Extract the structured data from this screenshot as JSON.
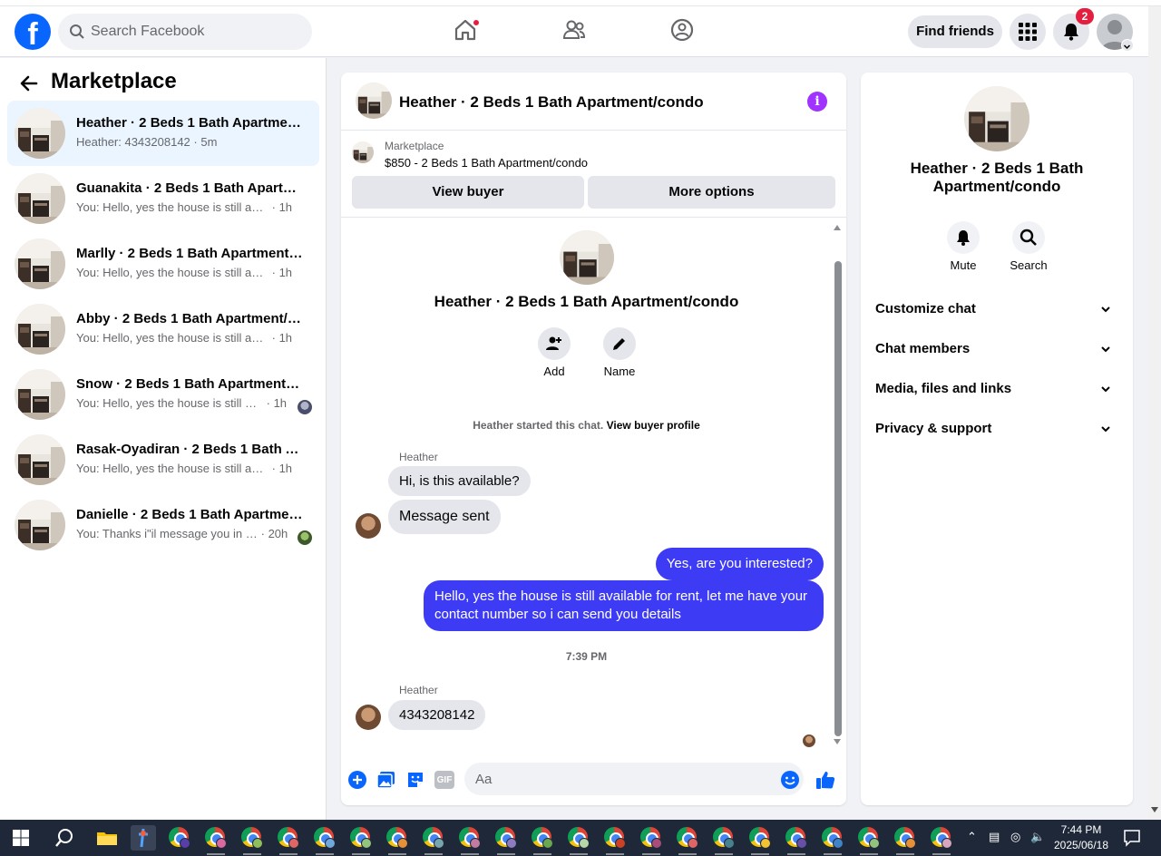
{
  "topbar": {
    "logo": "f",
    "search_placeholder": "Search Facebook",
    "nav_icons": [
      "home-icon",
      "friends-icon",
      "groups-icon"
    ],
    "find_friends": "Find friends",
    "notification_count": "2"
  },
  "left": {
    "title": "Marketplace",
    "conversations": [
      {
        "name": "Heather · 2 Beds 1 Bath Apartment/condo",
        "preview": "Heather: 4343208142",
        "time": "5m",
        "active": true
      },
      {
        "name": "Guanakita · 2 Beds 1 Bath Apartment/condo",
        "preview": "You: Hello, yes the house is still available for rent",
        "time": "1h"
      },
      {
        "name": "Marlly · 2 Beds 1 Bath Apartment/condo",
        "preview": "You: Hello, yes the house is still available for rent",
        "time": "1h"
      },
      {
        "name": "Abby · 2 Beds 1 Bath Apartment/condo",
        "preview": "You: Hello, yes the house is still available for rent",
        "time": "1h"
      },
      {
        "name": "Snow · 2 Beds 1 Bath Apartment/condo",
        "preview": "You: Hello, yes the house is still available for rent",
        "time": "1h"
      },
      {
        "name": "Rasak-Oyadiran · 2 Beds 1 Bath Apartment/condo",
        "preview": "You: Hello, yes the house is still available for rent",
        "time": "1h"
      },
      {
        "name": "Danielle · 2 Beds 1 Bath Apartment/condo",
        "preview": "You: Thanks i\"il message you in a moment",
        "time": "20h"
      }
    ]
  },
  "chat": {
    "title": "Heather · 2 Beds 1 Bath Apartment/condo",
    "listing_source": "Marketplace",
    "listing_price": "$850 - 2 Beds 1 Bath Apartment/condo",
    "view_buyer": "View buyer",
    "more_options": "More options",
    "big_title": "Heather · 2 Beds 1 Bath Apartment/condo",
    "add_label": "Add",
    "name_label": "Name",
    "started_text": "Heather started this chat.",
    "view_profile": "View buyer profile",
    "sender1": "Heather",
    "msg1": "Hi, is this available?",
    "msg2": "Message sent",
    "msg3": "Yes, are you interested?",
    "msg4": "Hello, yes the house is still available for rent, let me have your contact number so i can send you details",
    "timestamp": "7:39 PM",
    "sender2": "Heather",
    "msg5": "4343208142",
    "composer_placeholder": "Aa",
    "gif_label": "GIF"
  },
  "right": {
    "title": "Heather · 2 Beds 1 Bath Apartment/condo",
    "mute": "Mute",
    "search": "Search",
    "rows": [
      "Customize chat",
      "Chat members",
      "Media, files and links",
      "Privacy & support"
    ]
  },
  "taskbar": {
    "time": "7:44 PM",
    "date": "2025/06/18"
  },
  "colors": {
    "brand": "#0866ff",
    "outgoing_bubble": "#3e3bf5",
    "active_row": "#ebf5ff",
    "info": "#a033ff"
  }
}
